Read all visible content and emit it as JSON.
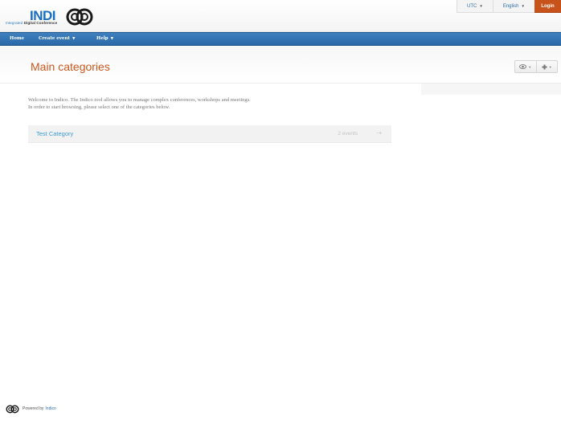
{
  "header": {
    "logo_subtitle_prefix": "Integrated",
    "logo_subtitle_bold": "Digital Conference",
    "logo_word": "INDI",
    "timezone": "UTC",
    "language": "English",
    "login": "Login"
  },
  "nav": {
    "home": "Home",
    "create_event": "Create event",
    "help": "Help"
  },
  "main": {
    "title": "Main categories",
    "welcome_line1": "Welcome to Indico. The Indico tool allows you to manage complex conferences, workshops and meetings.",
    "welcome_line2": "In order to start browsing, please select one of the categories below.",
    "categories": [
      {
        "name": "Test Category",
        "count": "2 events"
      }
    ]
  },
  "footer": {
    "powered_by": "Powered by",
    "link": "Indico"
  },
  "colors": {
    "accent_orange": "#c9571c",
    "nav_blue": "#2b6aa8",
    "link_blue": "#3d9bd6"
  },
  "icons": [
    "eye-icon",
    "plus-icon",
    "arrow-right-icon",
    "indico-logo-icon"
  ]
}
